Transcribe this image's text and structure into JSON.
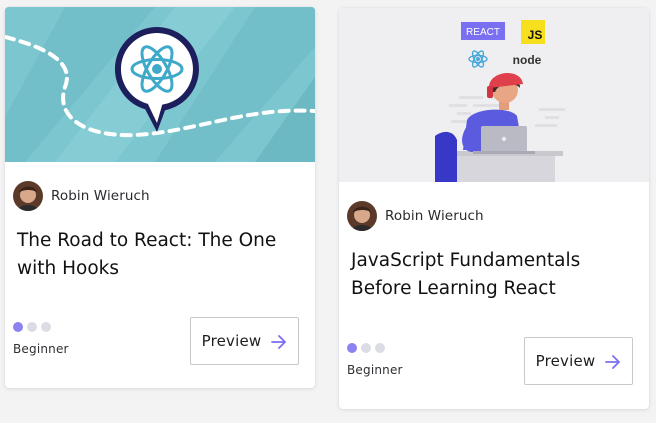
{
  "courses": [
    {
      "author": "Robin Wieruch",
      "title": "The Road to React: The One with Hooks",
      "level": "Beginner",
      "level_progress": 1,
      "level_max": 3,
      "cta": "Preview",
      "cover_icon": "react-logo-in-speech-bubble",
      "cover_color": "#7cc6cf"
    },
    {
      "author": "Robin Wieruch",
      "title": "JavaScript Fundamentals Before Learning React",
      "level": "Beginner",
      "level_progress": 1,
      "level_max": 3,
      "cta": "Preview",
      "cover_labels": {
        "react_badge": "REACT",
        "js_badge": "JS",
        "node_logo": "node"
      },
      "cover_color": "#efeff1"
    }
  ],
  "colors": {
    "accent": "#7a6ff0",
    "dot_inactive": "#dcdce4"
  }
}
